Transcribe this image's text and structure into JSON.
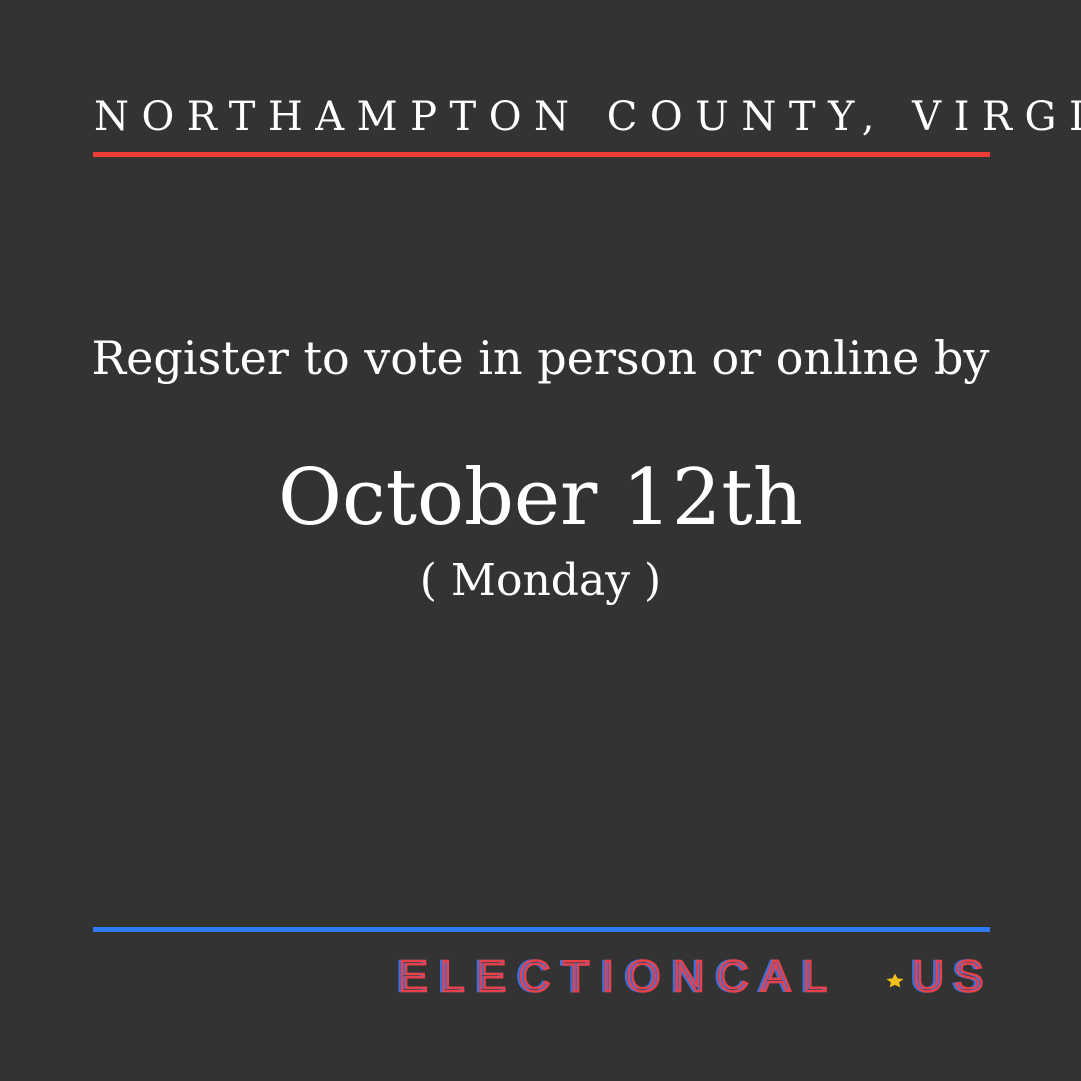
{
  "region": "NORTHAMPTON COUNTY, VIRGINIA",
  "lead": "Register to vote in person or online by",
  "date": "October 12th",
  "weekday": "( Monday )",
  "logo": {
    "text": "ELECTIONCAL.US",
    "left_text": "ELECTIONCAL",
    "right_text": "US",
    "star_icon": "star-icon"
  },
  "colors": {
    "background": "#333333",
    "text": "#ffffff",
    "accent_red": "#ee3b36",
    "accent_blue": "#2f7af5",
    "logo_red": "#e8414a",
    "logo_blue": "#3f6fd8",
    "star": "#f2c21b"
  }
}
